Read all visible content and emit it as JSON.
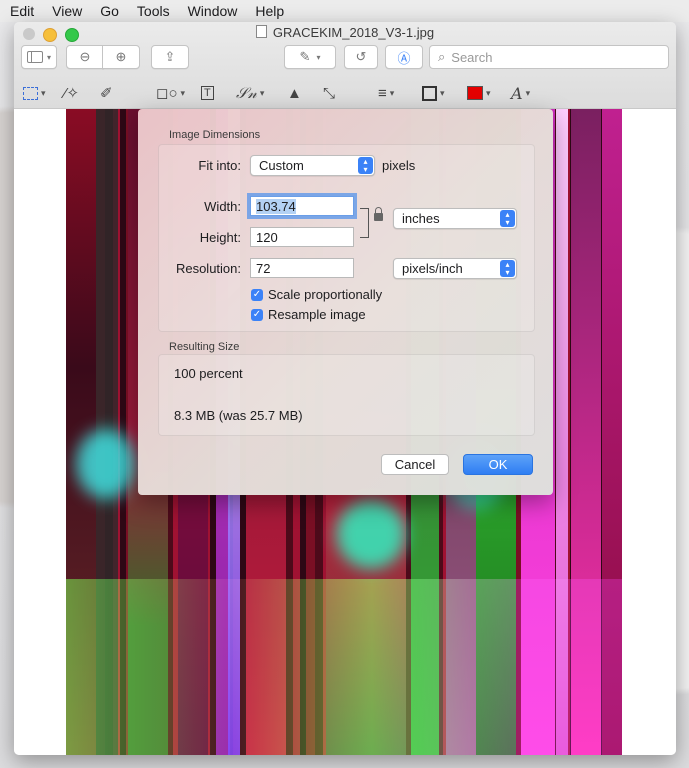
{
  "menubar": {
    "items": [
      "Edit",
      "View",
      "Go",
      "Tools",
      "Window",
      "Help"
    ]
  },
  "window": {
    "title": "GRACEKIM_2018_V3-1.jpg"
  },
  "toolbar": {
    "search_placeholder": "Search",
    "icons": [
      "sidebar-icon",
      "zoom-out-icon",
      "zoom-in-icon",
      "share-icon",
      "pen-icon",
      "rotate-icon",
      "markup-icon",
      "rect-select-icon",
      "magic-wand-icon",
      "sketch-icon",
      "shapes-icon",
      "text-icon",
      "sign-icon",
      "adjust-color-icon",
      "adjust-size-icon",
      "lines-icon",
      "border-icon",
      "color-icon",
      "font-icon"
    ],
    "fill_color": "#e50000"
  },
  "dialog": {
    "image_dimensions_label": "Image Dimensions",
    "fit_into_label": "Fit into:",
    "fit_into_value": "Custom",
    "fit_into_unit": "pixels",
    "width_label": "Width:",
    "width_value": "103.74",
    "height_label": "Height:",
    "height_value": "120",
    "dimension_unit": "inches",
    "resolution_label": "Resolution:",
    "resolution_value": "72",
    "resolution_unit": "pixels/inch",
    "scale_label": "Scale proportionally",
    "scale_checked": true,
    "resample_label": "Resample image",
    "resample_checked": true,
    "resulting_size_label": "Resulting Size",
    "percent_text": "100 percent",
    "size_text": "8.3 MB (was 25.7 MB)",
    "cancel_label": "Cancel",
    "ok_label": "OK"
  },
  "colors": {
    "accent": "#3b82f7"
  }
}
